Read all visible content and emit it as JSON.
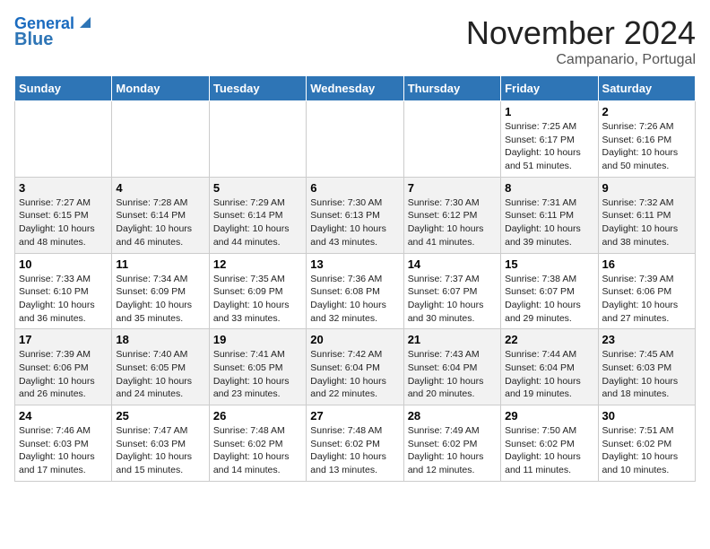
{
  "header": {
    "logo_line1": "General",
    "logo_line2": "Blue",
    "month": "November 2024",
    "location": "Campanario, Portugal"
  },
  "weekdays": [
    "Sunday",
    "Monday",
    "Tuesday",
    "Wednesday",
    "Thursday",
    "Friday",
    "Saturday"
  ],
  "weeks": [
    [
      {
        "day": "",
        "info": ""
      },
      {
        "day": "",
        "info": ""
      },
      {
        "day": "",
        "info": ""
      },
      {
        "day": "",
        "info": ""
      },
      {
        "day": "",
        "info": ""
      },
      {
        "day": "1",
        "info": "Sunrise: 7:25 AM\nSunset: 6:17 PM\nDaylight: 10 hours\nand 51 minutes."
      },
      {
        "day": "2",
        "info": "Sunrise: 7:26 AM\nSunset: 6:16 PM\nDaylight: 10 hours\nand 50 minutes."
      }
    ],
    [
      {
        "day": "3",
        "info": "Sunrise: 7:27 AM\nSunset: 6:15 PM\nDaylight: 10 hours\nand 48 minutes."
      },
      {
        "day": "4",
        "info": "Sunrise: 7:28 AM\nSunset: 6:14 PM\nDaylight: 10 hours\nand 46 minutes."
      },
      {
        "day": "5",
        "info": "Sunrise: 7:29 AM\nSunset: 6:14 PM\nDaylight: 10 hours\nand 44 minutes."
      },
      {
        "day": "6",
        "info": "Sunrise: 7:30 AM\nSunset: 6:13 PM\nDaylight: 10 hours\nand 43 minutes."
      },
      {
        "day": "7",
        "info": "Sunrise: 7:30 AM\nSunset: 6:12 PM\nDaylight: 10 hours\nand 41 minutes."
      },
      {
        "day": "8",
        "info": "Sunrise: 7:31 AM\nSunset: 6:11 PM\nDaylight: 10 hours\nand 39 minutes."
      },
      {
        "day": "9",
        "info": "Sunrise: 7:32 AM\nSunset: 6:11 PM\nDaylight: 10 hours\nand 38 minutes."
      }
    ],
    [
      {
        "day": "10",
        "info": "Sunrise: 7:33 AM\nSunset: 6:10 PM\nDaylight: 10 hours\nand 36 minutes."
      },
      {
        "day": "11",
        "info": "Sunrise: 7:34 AM\nSunset: 6:09 PM\nDaylight: 10 hours\nand 35 minutes."
      },
      {
        "day": "12",
        "info": "Sunrise: 7:35 AM\nSunset: 6:09 PM\nDaylight: 10 hours\nand 33 minutes."
      },
      {
        "day": "13",
        "info": "Sunrise: 7:36 AM\nSunset: 6:08 PM\nDaylight: 10 hours\nand 32 minutes."
      },
      {
        "day": "14",
        "info": "Sunrise: 7:37 AM\nSunset: 6:07 PM\nDaylight: 10 hours\nand 30 minutes."
      },
      {
        "day": "15",
        "info": "Sunrise: 7:38 AM\nSunset: 6:07 PM\nDaylight: 10 hours\nand 29 minutes."
      },
      {
        "day": "16",
        "info": "Sunrise: 7:39 AM\nSunset: 6:06 PM\nDaylight: 10 hours\nand 27 minutes."
      }
    ],
    [
      {
        "day": "17",
        "info": "Sunrise: 7:39 AM\nSunset: 6:06 PM\nDaylight: 10 hours\nand 26 minutes."
      },
      {
        "day": "18",
        "info": "Sunrise: 7:40 AM\nSunset: 6:05 PM\nDaylight: 10 hours\nand 24 minutes."
      },
      {
        "day": "19",
        "info": "Sunrise: 7:41 AM\nSunset: 6:05 PM\nDaylight: 10 hours\nand 23 minutes."
      },
      {
        "day": "20",
        "info": "Sunrise: 7:42 AM\nSunset: 6:04 PM\nDaylight: 10 hours\nand 22 minutes."
      },
      {
        "day": "21",
        "info": "Sunrise: 7:43 AM\nSunset: 6:04 PM\nDaylight: 10 hours\nand 20 minutes."
      },
      {
        "day": "22",
        "info": "Sunrise: 7:44 AM\nSunset: 6:04 PM\nDaylight: 10 hours\nand 19 minutes."
      },
      {
        "day": "23",
        "info": "Sunrise: 7:45 AM\nSunset: 6:03 PM\nDaylight: 10 hours\nand 18 minutes."
      }
    ],
    [
      {
        "day": "24",
        "info": "Sunrise: 7:46 AM\nSunset: 6:03 PM\nDaylight: 10 hours\nand 17 minutes."
      },
      {
        "day": "25",
        "info": "Sunrise: 7:47 AM\nSunset: 6:03 PM\nDaylight: 10 hours\nand 15 minutes."
      },
      {
        "day": "26",
        "info": "Sunrise: 7:48 AM\nSunset: 6:02 PM\nDaylight: 10 hours\nand 14 minutes."
      },
      {
        "day": "27",
        "info": "Sunrise: 7:48 AM\nSunset: 6:02 PM\nDaylight: 10 hours\nand 13 minutes."
      },
      {
        "day": "28",
        "info": "Sunrise: 7:49 AM\nSunset: 6:02 PM\nDaylight: 10 hours\nand 12 minutes."
      },
      {
        "day": "29",
        "info": "Sunrise: 7:50 AM\nSunset: 6:02 PM\nDaylight: 10 hours\nand 11 minutes."
      },
      {
        "day": "30",
        "info": "Sunrise: 7:51 AM\nSunset: 6:02 PM\nDaylight: 10 hours\nand 10 minutes."
      }
    ]
  ]
}
